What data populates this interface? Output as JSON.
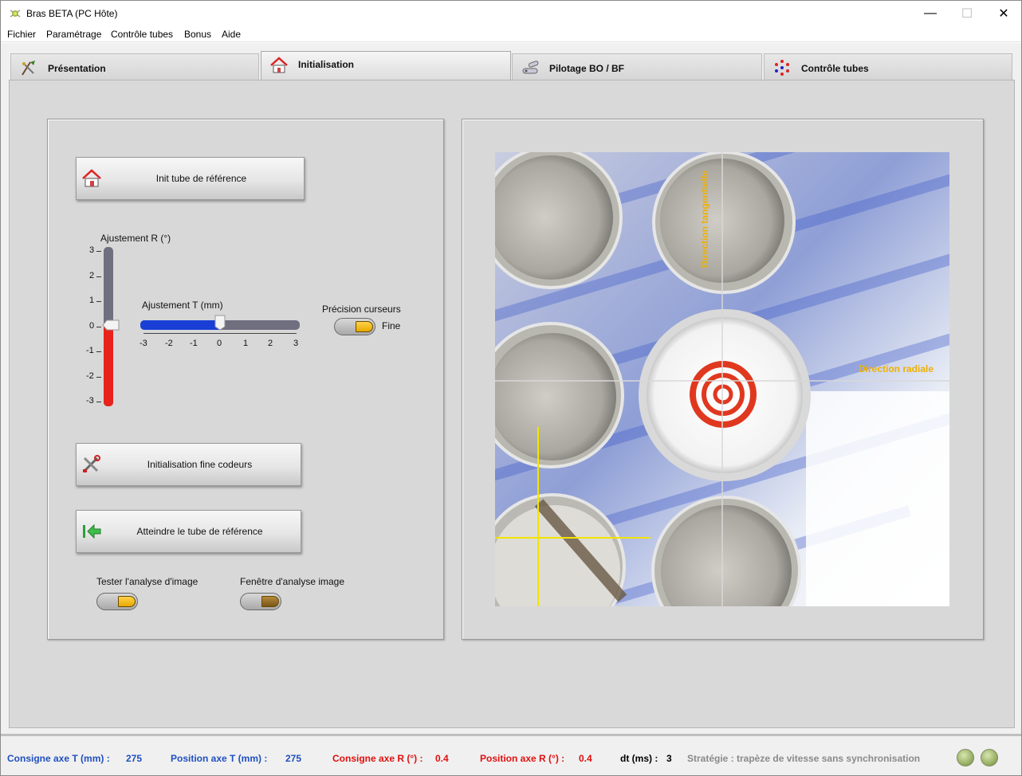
{
  "window": {
    "title": "Bras BETA (PC Hôte)",
    "min": "—",
    "max": "☐",
    "close": "✕"
  },
  "menu": [
    "Fichier",
    "Paramétrage",
    "Contrôle tubes",
    "Bonus",
    "Aide"
  ],
  "tabs": [
    {
      "label": "Présentation",
      "icon": "tools-feather-icon"
    },
    {
      "label": "Initialisation",
      "icon": "home-icon",
      "active": true
    },
    {
      "label": "Pilotage BO / BF",
      "icon": "robot-arm-icon"
    },
    {
      "label": "Contrôle tubes",
      "icon": "tube-ring-icon"
    }
  ],
  "left_panel": {
    "init_button": "Init tube de référence",
    "r_slider": {
      "label": "Ajustement R (°)",
      "ticks": [
        "3",
        "2",
        "1",
        "0",
        "-1",
        "-2",
        "-3"
      ],
      "value": 0
    },
    "t_slider": {
      "label": "Ajustement T (mm)",
      "ticks": [
        "-3",
        "-2",
        "-1",
        "0",
        "1",
        "2",
        "3"
      ],
      "value": 0
    },
    "precision": {
      "label": "Précision curseurs",
      "value_label": "Fine"
    },
    "fine_init_button": "Initialisation fine codeurs",
    "reach_button": "Atteindre le tube  de référence",
    "test_analysis_label": "Tester l'analyse d'image",
    "analysis_window_label": "Fenêtre d'analyse image"
  },
  "camera": {
    "tangential_label": "Direction tangentielle",
    "radial_label": "Direction radiale",
    "accent": "#f0b000"
  },
  "status": {
    "consigne_t_label": "Consigne axe T (mm) :",
    "consigne_t_value": "275",
    "position_t_label": "Position axe T (mm) :",
    "position_t_value": "275",
    "consigne_r_label": "Consigne axe R (°) :",
    "consigne_r_value": "0.4",
    "position_r_label": "Position axe R (°) :",
    "position_r_value": "0.4",
    "dt_label": "dt (ms) :",
    "dt_value": "3",
    "strategy": "Stratégie : trapèze de vitesse sans synchronisation",
    "colors": {
      "blue": "#1f4fbf",
      "red": "#e01010",
      "gray": "#8a8a8a"
    }
  }
}
